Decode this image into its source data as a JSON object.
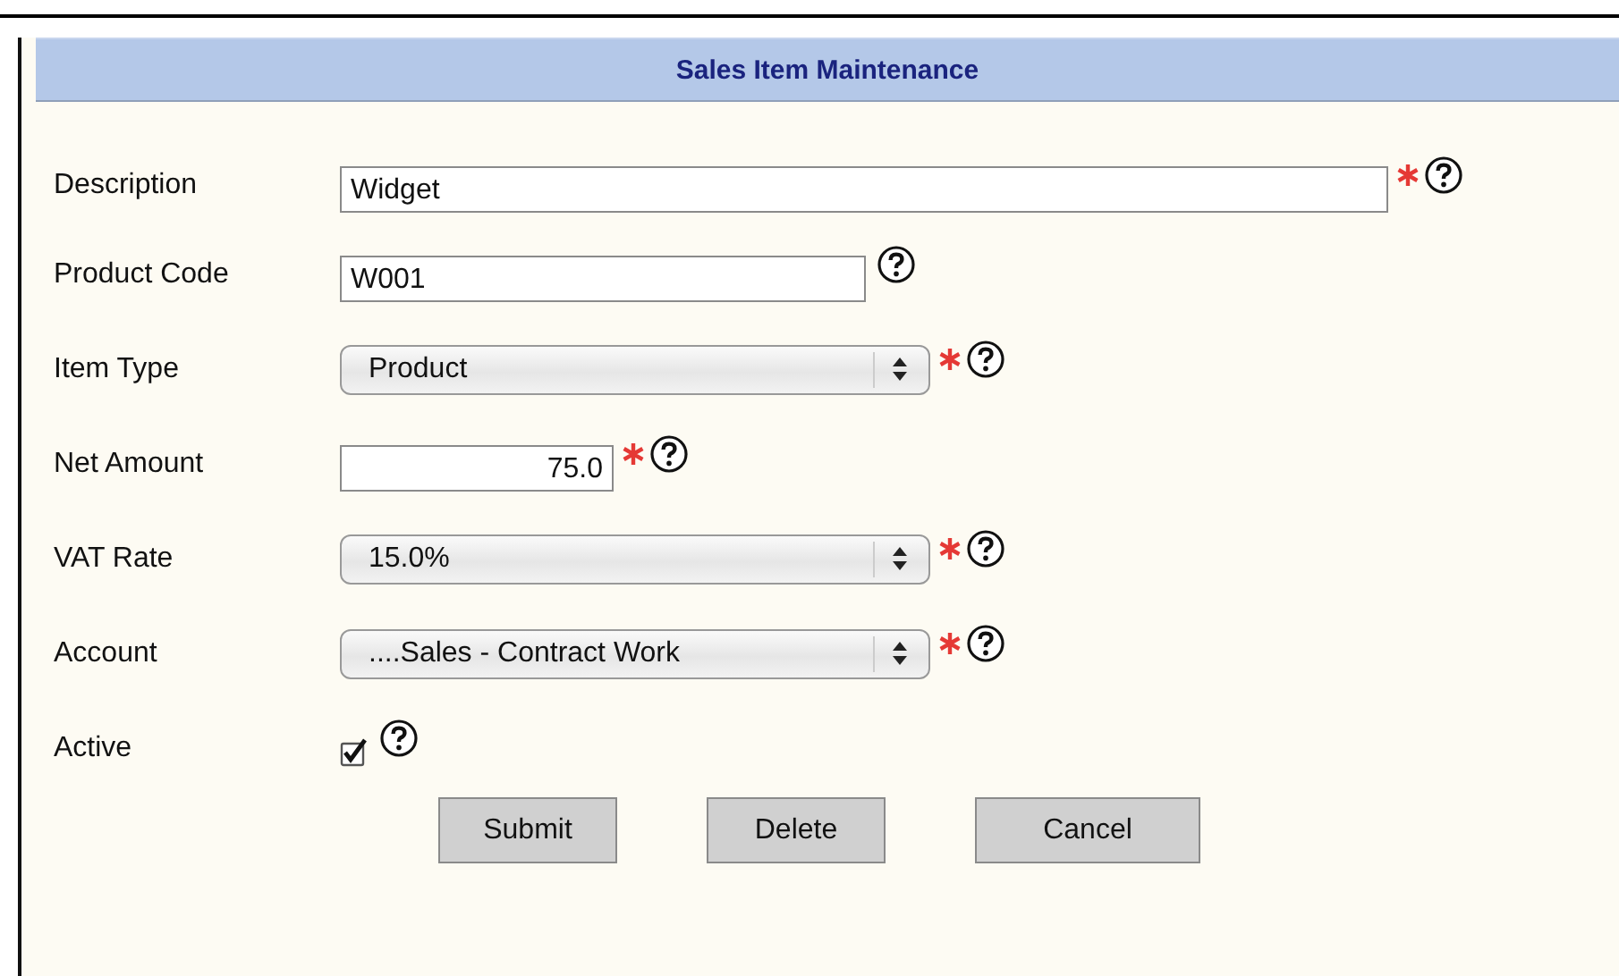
{
  "panel": {
    "title": "Sales Item Maintenance"
  },
  "fields": [
    {
      "label": "Description",
      "kind": "text",
      "value": "Widget",
      "required": true
    },
    {
      "label": "Product Code",
      "kind": "text",
      "value": "W001",
      "required": false
    },
    {
      "label": "Item Type",
      "kind": "select",
      "value": "Product",
      "required": true
    },
    {
      "label": "Net Amount",
      "kind": "number",
      "value": "75.0",
      "required": true
    },
    {
      "label": "VAT Rate",
      "kind": "select",
      "value": "15.0%",
      "required": true
    },
    {
      "label": "Account",
      "kind": "select",
      "value": "....Sales - Contract Work",
      "required": true
    },
    {
      "label": "Active",
      "kind": "checkbox",
      "checked": true,
      "required": false
    }
  ],
  "buttons": [
    "Submit",
    "Delete",
    "Cancel"
  ]
}
